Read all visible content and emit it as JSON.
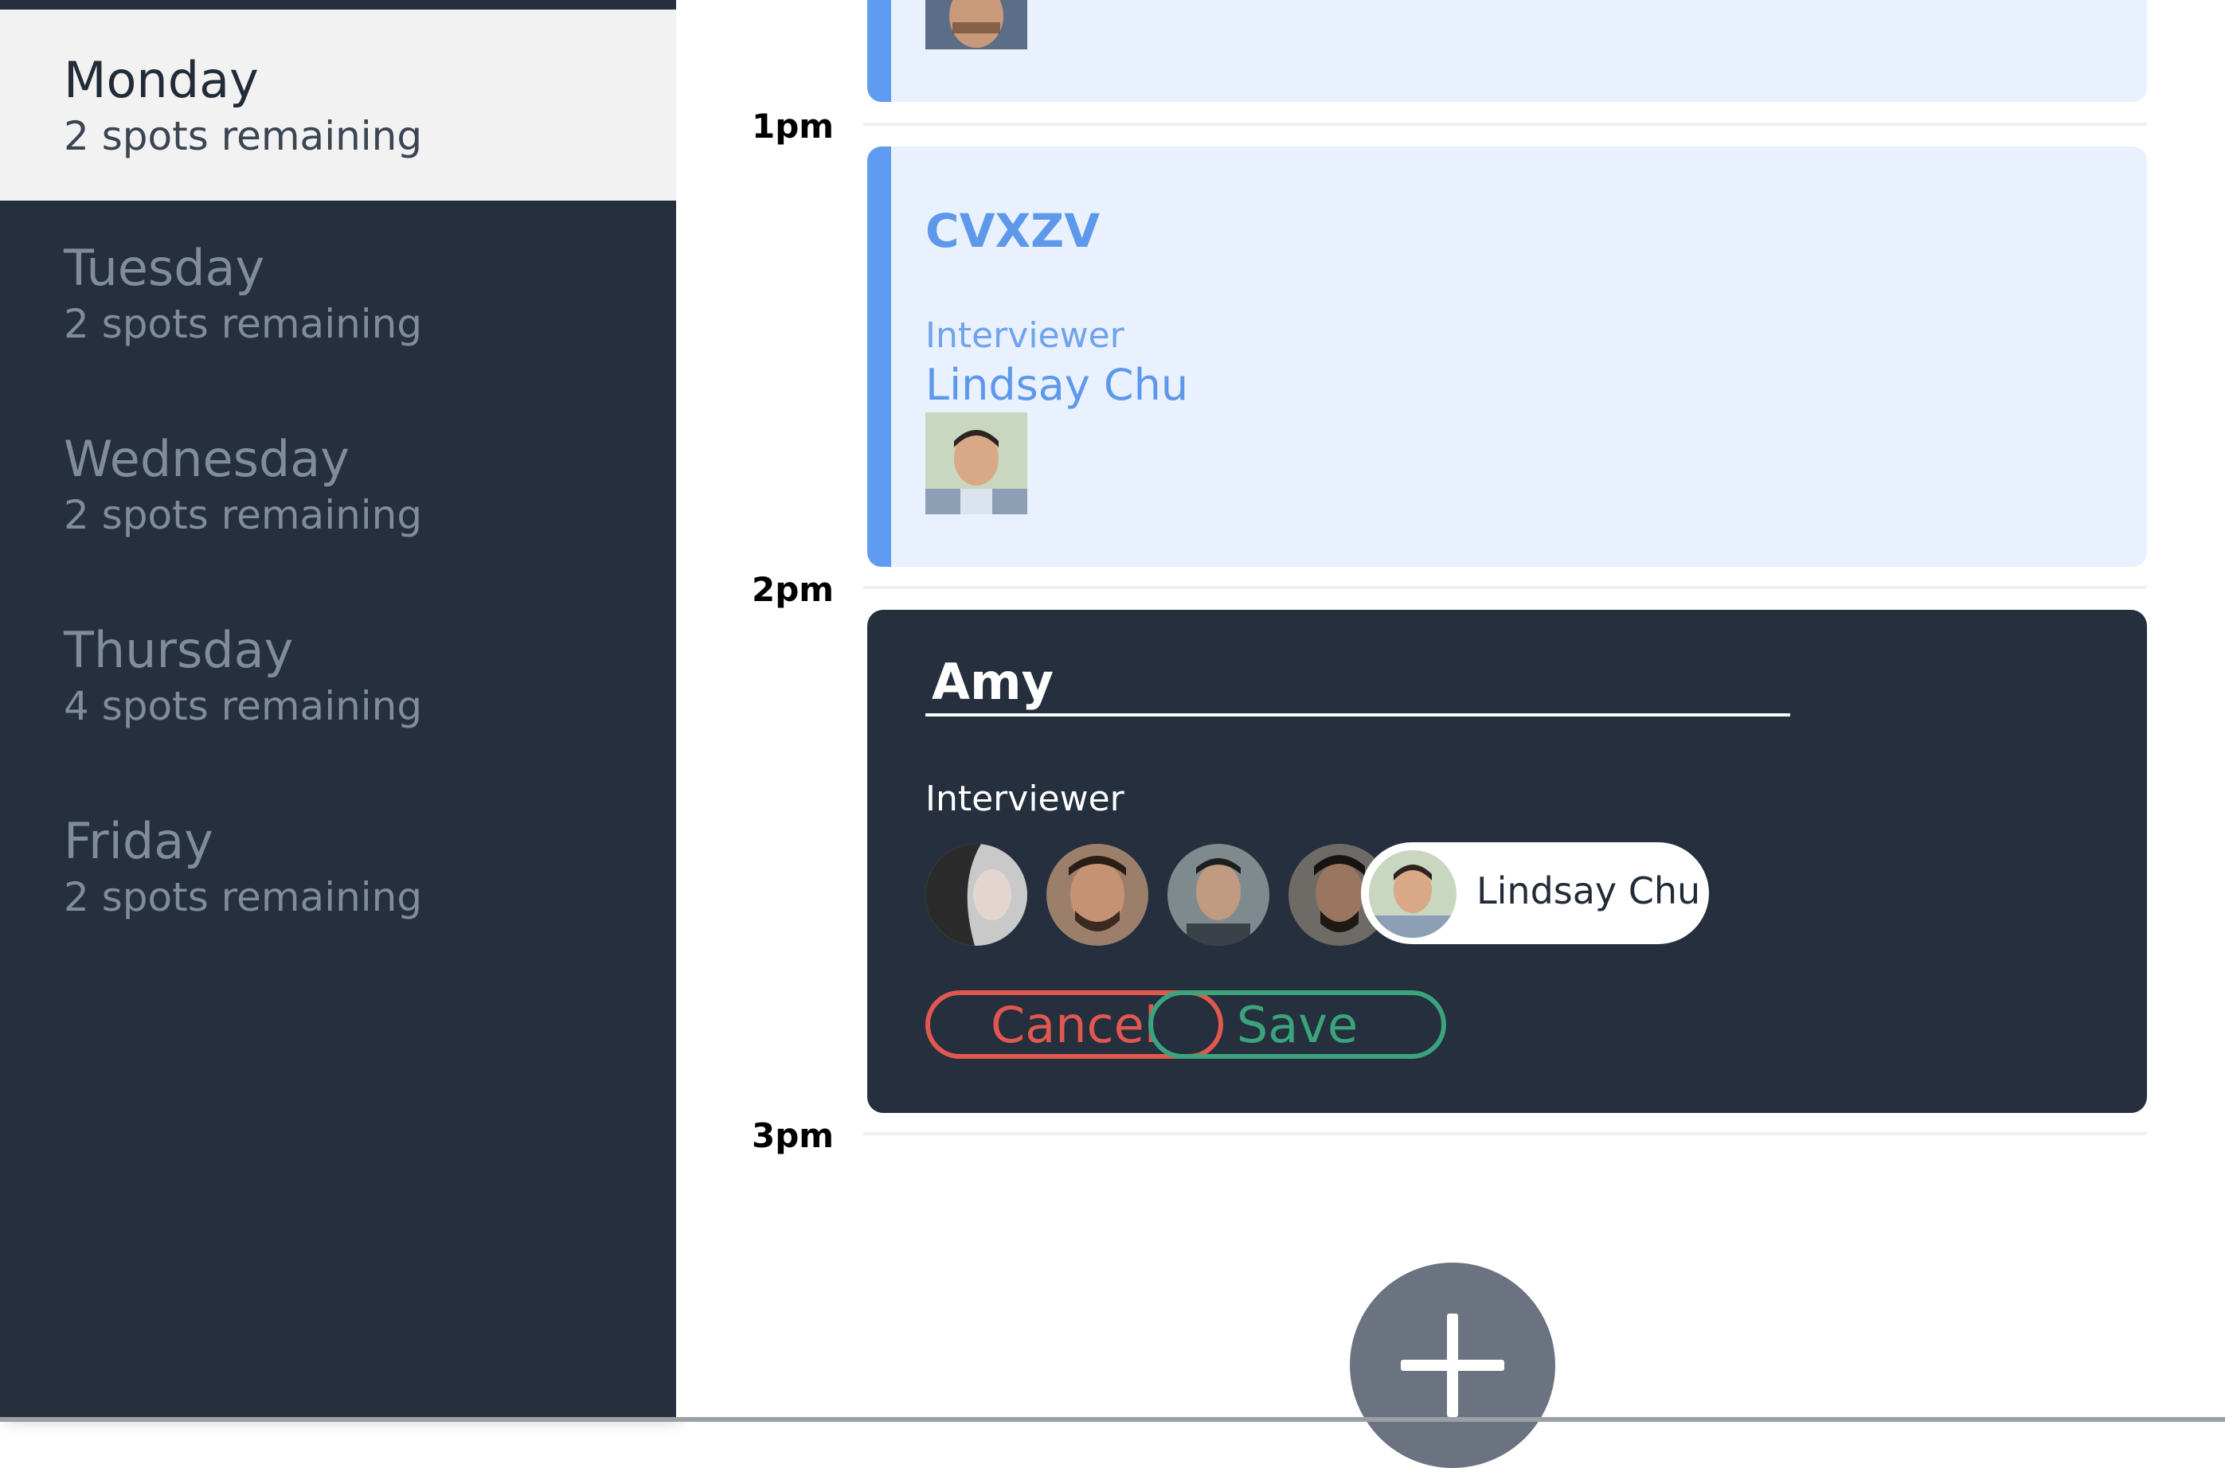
{
  "sidebar": {
    "days": [
      {
        "name": "Monday",
        "spots": "2 spots remaining",
        "active": true
      },
      {
        "name": "Tuesday",
        "spots": "2 spots remaining",
        "active": false
      },
      {
        "name": "Wednesday",
        "spots": "2 spots remaining",
        "active": false
      },
      {
        "name": "Thursday",
        "spots": "4 spots remaining",
        "active": false
      },
      {
        "name": "Friday",
        "spots": "2 spots remaining",
        "active": false
      }
    ]
  },
  "schedule": {
    "times": [
      "1pm",
      "2pm",
      "3pm"
    ],
    "event": {
      "title": "CVXZV",
      "interviewer_label": "Interviewer",
      "interviewer_name": "Lindsay Chu"
    },
    "edit": {
      "candidate_value": "Amy",
      "interviewer_label": "Interviewer",
      "selected_interviewer": "Lindsay Chu",
      "cancel_label": "Cancel",
      "save_label": "Save"
    }
  },
  "colors": {
    "sidebar_bg": "#252f3e",
    "event_accent": "#5f9bf0",
    "cancel": "#e0584f",
    "save": "#3aa47d"
  },
  "icons": {
    "fab": "plus-icon"
  }
}
